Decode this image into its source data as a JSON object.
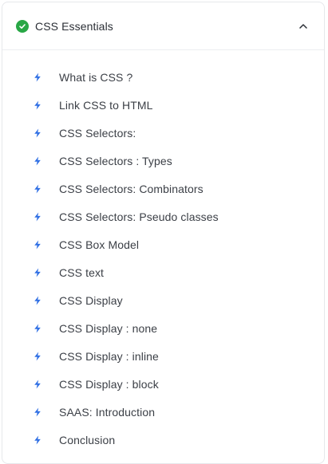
{
  "section": {
    "title": "CSS Essentials",
    "completed": true,
    "expanded": true,
    "status_icon": "check-circle-icon",
    "toggle_icon": "chevron-up-icon"
  },
  "colors": {
    "complete_green": "#28a745",
    "bolt_blue": "#2f6fe4",
    "text": "#3b3f46",
    "border": "#e6e8eb"
  },
  "lessons": [
    {
      "label": "What is CSS ?",
      "icon": "bolt-icon"
    },
    {
      "label": "Link CSS to HTML",
      "icon": "bolt-icon"
    },
    {
      "label": "CSS Selectors:",
      "icon": "bolt-icon"
    },
    {
      "label": "CSS Selectors : Types",
      "icon": "bolt-icon"
    },
    {
      "label": "CSS Selectors: Combinators",
      "icon": "bolt-icon"
    },
    {
      "label": "CSS Selectors: Pseudo classes",
      "icon": "bolt-icon"
    },
    {
      "label": "CSS Box Model",
      "icon": "bolt-icon"
    },
    {
      "label": "CSS text",
      "icon": "bolt-icon"
    },
    {
      "label": "CSS Display",
      "icon": "bolt-icon"
    },
    {
      "label": "CSS Display : none",
      "icon": "bolt-icon"
    },
    {
      "label": "CSS Display : inline",
      "icon": "bolt-icon"
    },
    {
      "label": "CSS Display : block",
      "icon": "bolt-icon"
    },
    {
      "label": "SAAS: Introduction",
      "icon": "bolt-icon"
    },
    {
      "label": "Conclusion",
      "icon": "bolt-icon"
    }
  ]
}
